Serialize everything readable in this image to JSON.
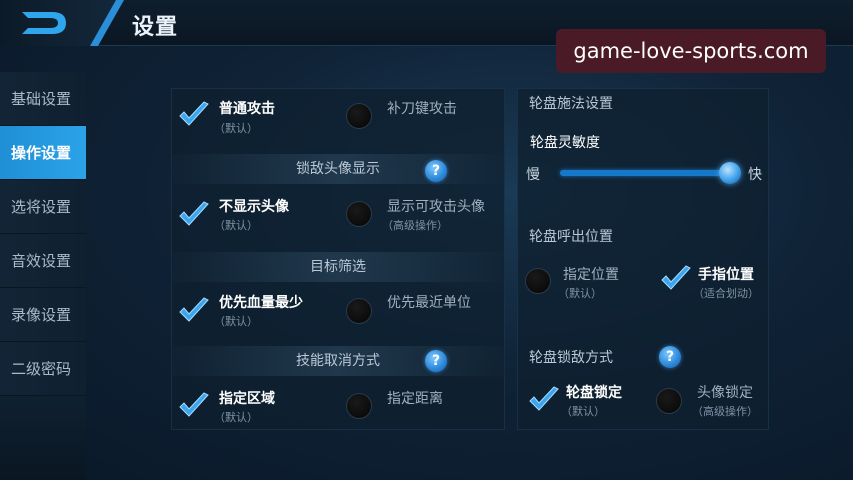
{
  "header": {
    "title": "设置"
  },
  "watermark": "game-love-sports.com",
  "sidebar": {
    "items": [
      {
        "label": "基础设置",
        "active": false
      },
      {
        "label": "操作设置",
        "active": true
      },
      {
        "label": "选将设置",
        "active": false
      },
      {
        "label": "音效设置",
        "active": false
      },
      {
        "label": "录像设置",
        "active": false
      },
      {
        "label": "二级密码",
        "active": false
      }
    ]
  },
  "left": {
    "attack": {
      "option_a": {
        "label": "普通攻击",
        "sub": "（默认）",
        "checked": true
      },
      "option_b": {
        "label": "补刀键攻击",
        "checked": false
      }
    },
    "lock_avatar": {
      "header": "锁敌头像显示",
      "help": "?",
      "option_a": {
        "label": "不显示头像",
        "sub": "（默认）",
        "checked": true
      },
      "option_b": {
        "label": "显示可攻击头像",
        "sub": "（高级操作）",
        "checked": false
      }
    },
    "target": {
      "header": "目标筛选",
      "option_a": {
        "label": "优先血量最少",
        "sub": "（默认）",
        "checked": true
      },
      "option_b": {
        "label": "优先最近单位",
        "checked": false
      }
    },
    "cancel": {
      "header": "技能取消方式",
      "help": "?",
      "option_a": {
        "label": "指定区域",
        "sub": "（默认）",
        "checked": true
      },
      "option_b": {
        "label": "指定距离",
        "checked": false
      }
    }
  },
  "right": {
    "cast": {
      "title": "轮盘施法设置",
      "sensitivity_label": "轮盘灵敏度",
      "slow": "慢",
      "fast": "快",
      "sensitivity_value": 1.0
    },
    "callout": {
      "title": "轮盘呼出位置",
      "option_a": {
        "label": "指定位置",
        "sub": "（默认）",
        "checked": false
      },
      "option_b": {
        "label": "手指位置",
        "sub": "（适合划动）",
        "checked": true
      }
    },
    "lock": {
      "title": "轮盘锁敌方式",
      "help": "?",
      "option_a": {
        "label": "轮盘锁定",
        "sub": "（默认）",
        "checked": true
      },
      "option_b": {
        "label": "头像锁定",
        "sub": "（高级操作）",
        "checked": false
      }
    }
  },
  "colors": {
    "accent": "#2ba3e8",
    "check": "#3aa6f0",
    "watermark_bg": "#4a1a26"
  }
}
